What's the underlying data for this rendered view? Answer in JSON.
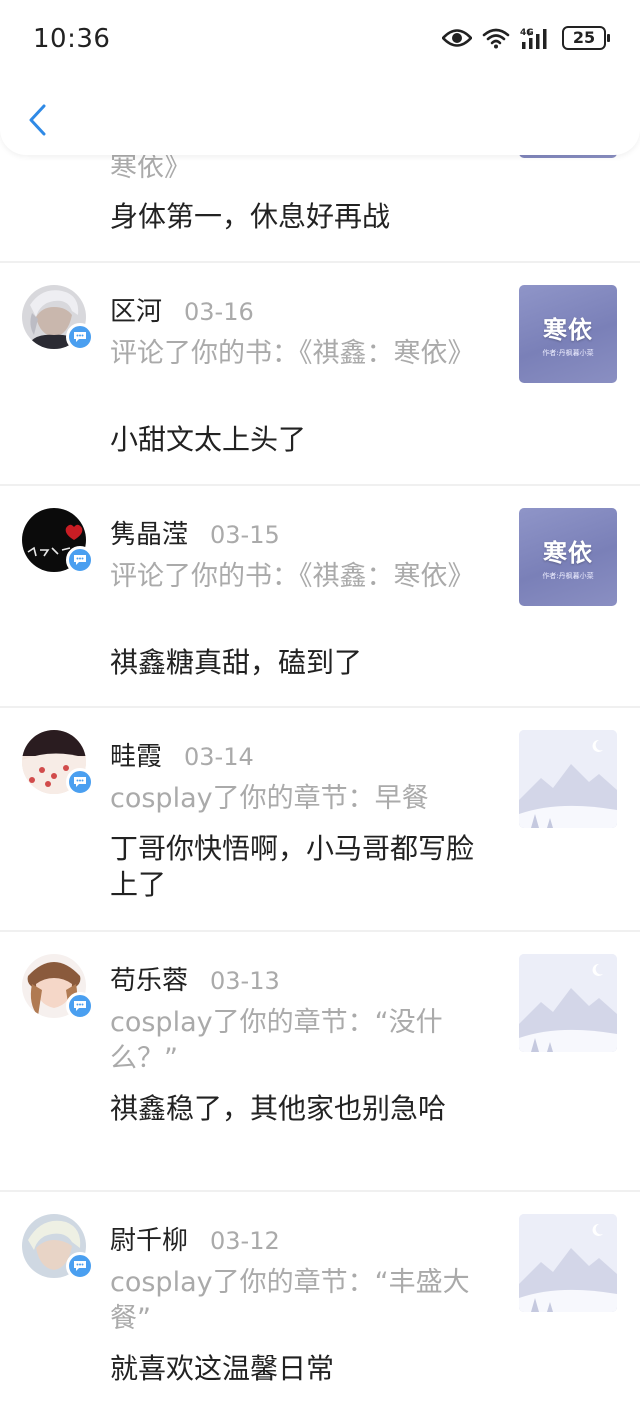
{
  "status_bar": {
    "time": "10:36",
    "battery": "25",
    "network": "4G"
  },
  "nav": {
    "back_icon": "chevron-left-icon",
    "accent_color": "#2f8ae6"
  },
  "notifications": [
    {
      "desc": "寒依》",
      "comment": "身体第一，休息好再战",
      "thumb": "cover"
    },
    {
      "name": "区河",
      "date": "03-16",
      "desc": "评论了你的书：《祺鑫：寒依》",
      "comment": "小甜文太上头了",
      "thumb": "cover",
      "thumb_title": "寒依",
      "thumb_sub": "作者:丹枫暮小菜"
    },
    {
      "name": "隽晶滢",
      "date": "03-15",
      "desc": "评论了你的书：《祺鑫：寒依》",
      "comment": "祺鑫糖真甜，磕到了",
      "thumb": "cover",
      "thumb_title": "寒依",
      "thumb_sub": "作者:丹枫暮小菜"
    },
    {
      "name": "畦霞",
      "date": "03-14",
      "desc": "cosplay了你的章节：早餐",
      "comment": "丁哥你快悟啊，小马哥都写脸上了",
      "thumb": "placeholder"
    },
    {
      "name": "苟乐蓉",
      "date": "03-13",
      "desc": "cosplay了你的章节：“没什么？”",
      "comment": "祺鑫稳了，其他家也别急哈",
      "thumb": "placeholder"
    },
    {
      "name": "尉千柳",
      "date": "03-12",
      "desc": "cosplay了你的章节：“丰盛大餐”",
      "comment": "就喜欢这温馨日常",
      "thumb": "placeholder"
    }
  ],
  "colors": {
    "badge": "#4a9ff0",
    "secondary_text": "#aaaaaa",
    "cover": "#8489c0"
  }
}
